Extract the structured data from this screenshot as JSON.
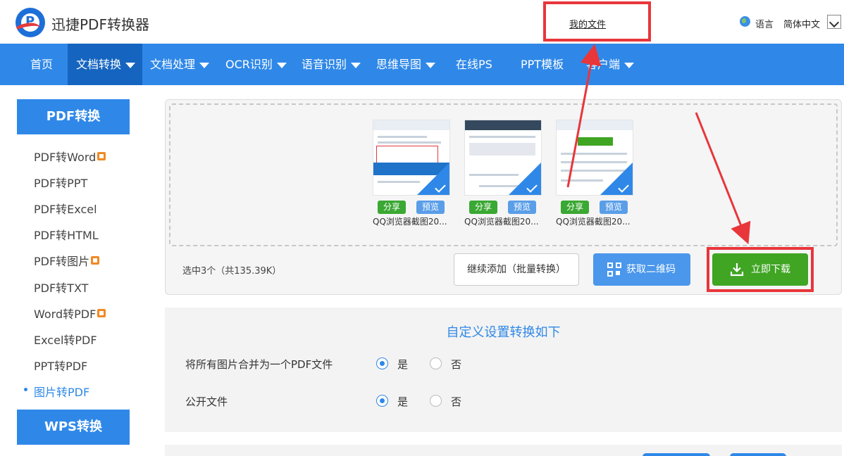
{
  "header": {
    "brand": "迅捷PDF转换器",
    "my_files": "我的文件",
    "language_label": "语言",
    "language_value": "简体中文"
  },
  "nav": {
    "items": [
      {
        "label": "首页"
      },
      {
        "label": "文档转换"
      },
      {
        "label": "文档处理"
      },
      {
        "label": "OCR识别"
      },
      {
        "label": "语音识别"
      },
      {
        "label": "思维导图"
      },
      {
        "label": "在线PS"
      },
      {
        "label": "PPT模板"
      },
      {
        "label": "客户端"
      }
    ]
  },
  "sidebar": {
    "section1_title": "PDF转换",
    "items": [
      {
        "label": "PDF转Word"
      },
      {
        "label": "PDF转PPT"
      },
      {
        "label": "PDF转Excel"
      },
      {
        "label": "PDF转HTML"
      },
      {
        "label": "PDF转图片"
      },
      {
        "label": "PDF转TXT"
      },
      {
        "label": "Word转PDF"
      },
      {
        "label": "Excel转PDF"
      },
      {
        "label": "PPT转PDF"
      },
      {
        "label": "图片转PDF"
      }
    ],
    "section2_title": "WPS转换"
  },
  "files": [
    {
      "name": "QQ浏览器截图20...",
      "share": "分享",
      "preview": "预览"
    },
    {
      "name": "QQ浏览器截图20...",
      "share": "分享",
      "preview": "预览"
    },
    {
      "name": "QQ浏览器截图20...",
      "share": "分享",
      "preview": "预览"
    }
  ],
  "actions": {
    "selected_info": "选中3个（共135.39K）",
    "continue_label": "继续添加（批量转换）",
    "qr_label": "获取二维码",
    "download_label": "立即下载"
  },
  "settings": {
    "title": "自定义设置转换如下",
    "options": [
      {
        "label": "将所有图片合并为一个PDF文件",
        "yes": "是",
        "no": "否",
        "selected": "yes"
      },
      {
        "label": "公开文件",
        "yes": "是",
        "no": "否",
        "selected": "yes"
      }
    ]
  },
  "colors": {
    "primary": "#2f88e8",
    "nav_active": "#1565c0",
    "download_green": "#3fa523",
    "highlight_red": "#e8363b"
  }
}
